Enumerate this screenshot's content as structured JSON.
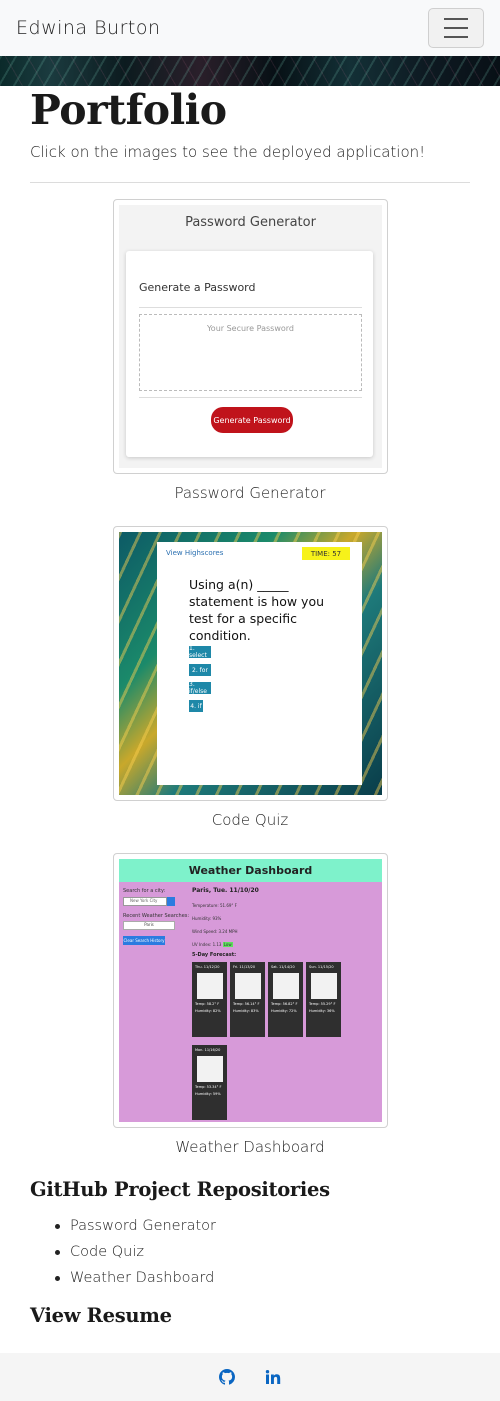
{
  "navbar": {
    "brand": "Edwina Burton",
    "toggle_icon": "hamburger-menu-icon"
  },
  "main": {
    "title": "Portfolio",
    "subtitle": "Click on the images to see the deployed application!",
    "projects": [
      {
        "caption": "Password Generator",
        "preview": {
          "title": "Password Generator",
          "heading": "Generate a Password",
          "placeholder": "Your Secure Password",
          "button": "Generate Password"
        }
      },
      {
        "caption": "Code Quiz",
        "preview": {
          "link": "View Highscores",
          "timer": "TIME: 57",
          "question": "Using a(n) _____ statement is how you test for a specific condition.",
          "options": [
            "1. select",
            "2. for",
            "3. if/else",
            "4. if"
          ]
        }
      },
      {
        "caption": "Weather Dashboard",
        "preview": {
          "title": "Weather Dashboard",
          "search_label": "Search for a city:",
          "search_value": "New York City",
          "recent_label": "Recent Weather Searches:",
          "recent_item": "Paris",
          "clear_button": "Clear Search History",
          "city": "Paris, Tue. 11/10/20",
          "temperature": "Temperature: 51.69° F",
          "humidity": "Humidity: 93%",
          "wind": "Wind Speed: 3.24 MPH",
          "uv": "UV Index: 1.13",
          "uv_badge": "Low",
          "forecast_label": "5-Day Forecast:",
          "forecast": [
            {
              "day": "Thu. 11/12/20",
              "temp": "Temp: 58.2° F",
              "humidity": "Humidity: 82%"
            },
            {
              "day": "Fri. 11/13/20",
              "temp": "Temp: 56.14° F",
              "humidity": "Humidity: 83%"
            },
            {
              "day": "Sat. 11/14/20",
              "temp": "Temp: 56.82° F",
              "humidity": "Humidity: 72%"
            },
            {
              "day": "Sun. 11/15/20",
              "temp": "Temp: 55.29° F",
              "humidity": "Humidity: 36%"
            },
            {
              "day": "Mon. 11/16/20",
              "temp": "Temp: 53.34° F",
              "humidity": "Humidity: 59%"
            }
          ]
        }
      }
    ]
  },
  "repositories": {
    "heading": "GitHub Project Repositories",
    "items": [
      "Password Generator",
      "Code Quiz",
      "Weather Dashboard"
    ]
  },
  "resume": {
    "heading": "View Resume"
  },
  "footer": {
    "icons": [
      "github-icon",
      "linkedin-icon"
    ],
    "accent": "#0a66c2"
  }
}
